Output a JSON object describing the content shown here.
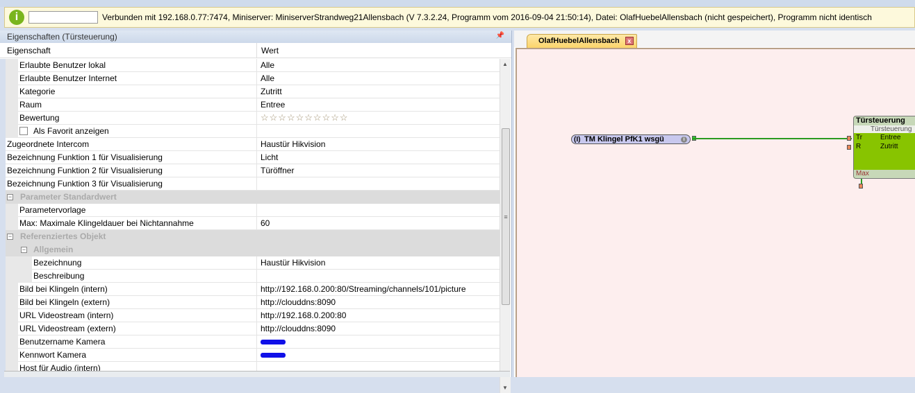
{
  "status_bar": {
    "info_icon": "info-icon",
    "input_value": "",
    "text": "Verbunden mit 192.168.0.77:7474, Miniserver: MiniserverStrandweg21Allensbach (V 7.3.2.24, Programm vom 2016-09-04 21:50:14), Datei: OlafHuebelAllensbach (nicht gespeichert), Programm nicht identisch"
  },
  "properties": {
    "title": "Eigenschaften (Türsteuerung)",
    "pin_icon": "pin-icon",
    "col_property": "Eigenschaft",
    "col_value": "Wert",
    "rows": [
      {
        "name": "Erlaubte Benutzer lokal",
        "value": "Alle"
      },
      {
        "name": "Erlaubte Benutzer Internet",
        "value": "Alle"
      },
      {
        "name": "Kategorie",
        "value": "Zutritt"
      },
      {
        "name": "Raum",
        "value": "Entree"
      },
      {
        "name": "Bewertung",
        "value": "☆☆☆☆☆☆☆☆☆☆"
      },
      {
        "name": "Als Favorit anzeigen",
        "value": ""
      },
      {
        "name": "Zugeordnete Intercom",
        "value": "Haustür Hikvision"
      },
      {
        "name": "Bezeichnung Funktion 1 für Visualisierung",
        "value": "Licht"
      },
      {
        "name": "Bezeichnung Funktion 2 für Visualisierung",
        "value": "Türöffner"
      },
      {
        "name": "Bezeichnung Funktion 3 für Visualisierung",
        "value": ""
      },
      {
        "name": "Parameter Standardwert",
        "value": ""
      },
      {
        "name": "Parametervorlage",
        "value": ""
      },
      {
        "name": "Max: Maximale Klingeldauer bei Nichtannahme",
        "value": "60"
      },
      {
        "name": "Referenziertes Objekt",
        "value": ""
      },
      {
        "name": "Allgemein",
        "value": ""
      },
      {
        "name": "Bezeichnung",
        "value": "Haustür Hikvision"
      },
      {
        "name": "Beschreibung",
        "value": ""
      },
      {
        "name": "Bild bei Klingeln (intern)",
        "value": "http://192.168.0.200:80/Streaming/channels/101/picture"
      },
      {
        "name": "Bild bei Klingeln (extern)",
        "value": "http://clouddns:8090"
      },
      {
        "name": "URL Videostream (intern)",
        "value": "http://192.168.0.200:80"
      },
      {
        "name": "URL Videostream (extern)",
        "value": "http://clouddns:8090"
      },
      {
        "name": "Benutzername Kamera",
        "value": ""
      },
      {
        "name": "Kennwort Kamera",
        "value": ""
      },
      {
        "name": "Host für Audio (intern)",
        "value": ""
      }
    ]
  },
  "editor": {
    "tab_label": "OlafHuebelAllensbach",
    "input_block": "TM Klingel PfK1 wsgü",
    "function_block": {
      "title": "Türsteuerung",
      "subtitle": "Türsteuerung",
      "inputs": [
        "Tr",
        "R"
      ],
      "outputs": [
        "Entree",
        "Zutritt"
      ],
      "parameter": "Max"
    },
    "wire_color": "#2a9a20",
    "block_color": "#88c400"
  }
}
